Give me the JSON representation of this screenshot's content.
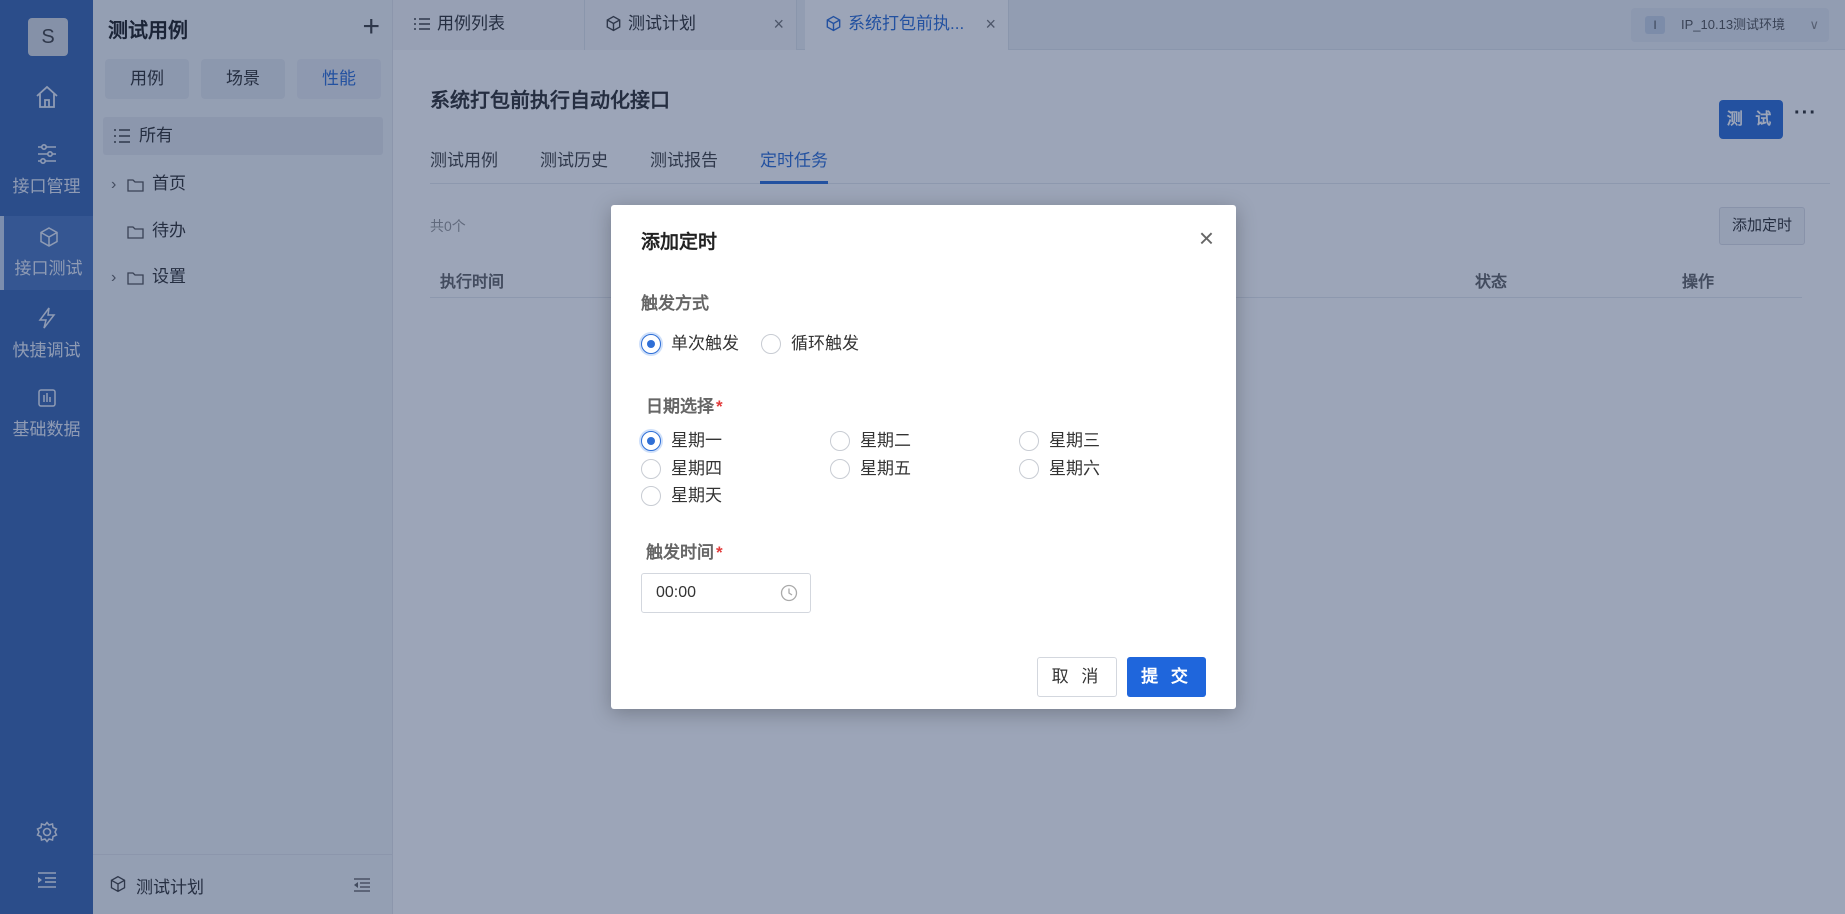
{
  "rail": {
    "avatar": "S",
    "items": [
      {
        "label": ""
      },
      {
        "label": "接口管理"
      },
      {
        "label": "接口测试"
      },
      {
        "label": "快捷调试"
      },
      {
        "label": "基础数据"
      }
    ]
  },
  "sidebar": {
    "title": "测试用例",
    "segments": [
      "用例",
      "场景",
      "性能"
    ],
    "all_label": "所有",
    "tree": [
      "首页",
      "待办",
      "设置"
    ],
    "footer_label": "测试计划"
  },
  "tabs": [
    {
      "label": "用例列表"
    },
    {
      "label": "测试计划",
      "close": "×"
    },
    {
      "label": "系统打包前执...",
      "close": "×"
    }
  ],
  "env": {
    "badge": "I",
    "label": "IP_10.13测试环境",
    "chevron": "∨"
  },
  "main": {
    "title": "系统打包前执行自动化接口",
    "test_button": "测 试",
    "more": "···",
    "subtabs": [
      "测试用例",
      "测试历史",
      "测试报告",
      "定时任务"
    ],
    "count": "共0个",
    "add_button": "添加定时",
    "columns": [
      "执行时间",
      "状态",
      "操作"
    ]
  },
  "dialog": {
    "title": "添加定时",
    "close": "×",
    "trigger_label": "触发方式",
    "trigger_options": [
      "单次触发",
      "循环触发"
    ],
    "date_label": "日期选择",
    "weekdays": [
      "星期一",
      "星期二",
      "星期三",
      "星期四",
      "星期五",
      "星期六",
      "星期天"
    ],
    "time_label": "触发时间",
    "time_value": "00:00",
    "required_mark": "*",
    "cancel": "取 消",
    "submit": "提 交"
  },
  "colors": {
    "accent": "#2f6fd6",
    "rail": "#3d68b0",
    "required": "#e23b3b"
  }
}
